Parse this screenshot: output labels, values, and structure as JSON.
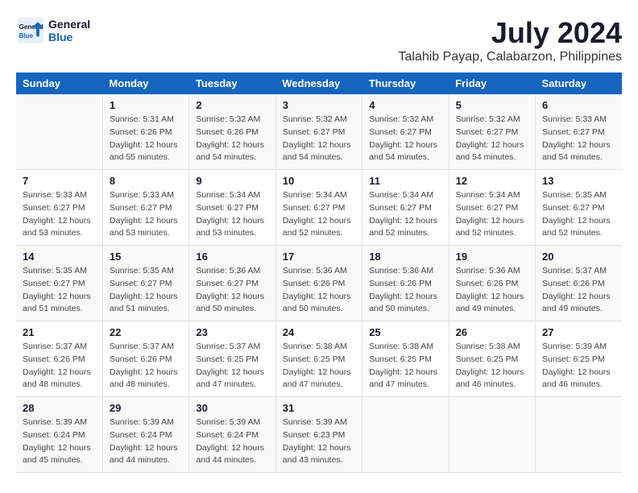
{
  "header": {
    "logo_line1": "General",
    "logo_line2": "Blue",
    "title": "July 2024",
    "subtitle": "Talahib Payap, Calabarzon, Philippines"
  },
  "days_of_week": [
    "Sunday",
    "Monday",
    "Tuesday",
    "Wednesday",
    "Thursday",
    "Friday",
    "Saturday"
  ],
  "weeks": [
    [
      {
        "day": "",
        "info": ""
      },
      {
        "day": "1",
        "info": "Sunrise: 5:31 AM\nSunset: 6:26 PM\nDaylight: 12 hours\nand 55 minutes."
      },
      {
        "day": "2",
        "info": "Sunrise: 5:32 AM\nSunset: 6:26 PM\nDaylight: 12 hours\nand 54 minutes."
      },
      {
        "day": "3",
        "info": "Sunrise: 5:32 AM\nSunset: 6:27 PM\nDaylight: 12 hours\nand 54 minutes."
      },
      {
        "day": "4",
        "info": "Sunrise: 5:32 AM\nSunset: 6:27 PM\nDaylight: 12 hours\nand 54 minutes."
      },
      {
        "day": "5",
        "info": "Sunrise: 5:32 AM\nSunset: 6:27 PM\nDaylight: 12 hours\nand 54 minutes."
      },
      {
        "day": "6",
        "info": "Sunrise: 5:33 AM\nSunset: 6:27 PM\nDaylight: 12 hours\nand 54 minutes."
      }
    ],
    [
      {
        "day": "7",
        "info": "Sunrise: 5:33 AM\nSunset: 6:27 PM\nDaylight: 12 hours\nand 53 minutes."
      },
      {
        "day": "8",
        "info": "Sunrise: 5:33 AM\nSunset: 6:27 PM\nDaylight: 12 hours\nand 53 minutes."
      },
      {
        "day": "9",
        "info": "Sunrise: 5:34 AM\nSunset: 6:27 PM\nDaylight: 12 hours\nand 53 minutes."
      },
      {
        "day": "10",
        "info": "Sunrise: 5:34 AM\nSunset: 6:27 PM\nDaylight: 12 hours\nand 52 minutes."
      },
      {
        "day": "11",
        "info": "Sunrise: 5:34 AM\nSunset: 6:27 PM\nDaylight: 12 hours\nand 52 minutes."
      },
      {
        "day": "12",
        "info": "Sunrise: 5:34 AM\nSunset: 6:27 PM\nDaylight: 12 hours\nand 52 minutes."
      },
      {
        "day": "13",
        "info": "Sunrise: 5:35 AM\nSunset: 6:27 PM\nDaylight: 12 hours\nand 52 minutes."
      }
    ],
    [
      {
        "day": "14",
        "info": "Sunrise: 5:35 AM\nSunset: 6:27 PM\nDaylight: 12 hours\nand 51 minutes."
      },
      {
        "day": "15",
        "info": "Sunrise: 5:35 AM\nSunset: 6:27 PM\nDaylight: 12 hours\nand 51 minutes."
      },
      {
        "day": "16",
        "info": "Sunrise: 5:36 AM\nSunset: 6:27 PM\nDaylight: 12 hours\nand 50 minutes."
      },
      {
        "day": "17",
        "info": "Sunrise: 5:36 AM\nSunset: 6:26 PM\nDaylight: 12 hours\nand 50 minutes."
      },
      {
        "day": "18",
        "info": "Sunrise: 5:36 AM\nSunset: 6:26 PM\nDaylight: 12 hours\nand 50 minutes."
      },
      {
        "day": "19",
        "info": "Sunrise: 5:36 AM\nSunset: 6:26 PM\nDaylight: 12 hours\nand 49 minutes."
      },
      {
        "day": "20",
        "info": "Sunrise: 5:37 AM\nSunset: 6:26 PM\nDaylight: 12 hours\nand 49 minutes."
      }
    ],
    [
      {
        "day": "21",
        "info": "Sunrise: 5:37 AM\nSunset: 6:26 PM\nDaylight: 12 hours\nand 48 minutes."
      },
      {
        "day": "22",
        "info": "Sunrise: 5:37 AM\nSunset: 6:26 PM\nDaylight: 12 hours\nand 48 minutes."
      },
      {
        "day": "23",
        "info": "Sunrise: 5:37 AM\nSunset: 6:25 PM\nDaylight: 12 hours\nand 47 minutes."
      },
      {
        "day": "24",
        "info": "Sunrise: 5:38 AM\nSunset: 6:25 PM\nDaylight: 12 hours\nand 47 minutes."
      },
      {
        "day": "25",
        "info": "Sunrise: 5:38 AM\nSunset: 6:25 PM\nDaylight: 12 hours\nand 47 minutes."
      },
      {
        "day": "26",
        "info": "Sunrise: 5:38 AM\nSunset: 6:25 PM\nDaylight: 12 hours\nand 46 minutes."
      },
      {
        "day": "27",
        "info": "Sunrise: 5:39 AM\nSunset: 6:25 PM\nDaylight: 12 hours\nand 46 minutes."
      }
    ],
    [
      {
        "day": "28",
        "info": "Sunrise: 5:39 AM\nSunset: 6:24 PM\nDaylight: 12 hours\nand 45 minutes."
      },
      {
        "day": "29",
        "info": "Sunrise: 5:39 AM\nSunset: 6:24 PM\nDaylight: 12 hours\nand 44 minutes."
      },
      {
        "day": "30",
        "info": "Sunrise: 5:39 AM\nSunset: 6:24 PM\nDaylight: 12 hours\nand 44 minutes."
      },
      {
        "day": "31",
        "info": "Sunrise: 5:39 AM\nSunset: 6:23 PM\nDaylight: 12 hours\nand 43 minutes."
      },
      {
        "day": "",
        "info": ""
      },
      {
        "day": "",
        "info": ""
      },
      {
        "day": "",
        "info": ""
      }
    ]
  ]
}
